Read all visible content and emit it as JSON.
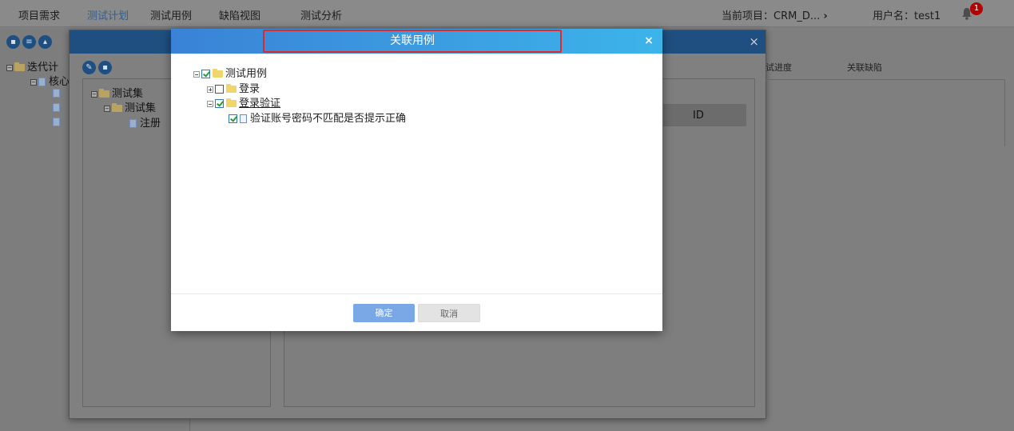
{
  "topnav": {
    "items": [
      "项目需求",
      "测试计划",
      "测试用例",
      "缺陷视图",
      "测试分析"
    ],
    "current_project": "当前项目：CRM_D...",
    "current_project_arrow": "›",
    "username": "用户名：test1",
    "notification_count": "1"
  },
  "bg_sidebar": {
    "tree": [
      "迭代计",
      "核心"
    ]
  },
  "bg_dialog": {
    "close": "×",
    "tree": {
      "root": "测试集",
      "child": "测试集",
      "leaf": "注册"
    },
    "tabs": [
      "试进度",
      "关联缺陷"
    ],
    "table_header_id": "ID"
  },
  "modal": {
    "title": "关联用例",
    "close": "×",
    "tree": {
      "root": "测试用例",
      "node1": "登录",
      "node2": "登录验证",
      "node2_child": "验证账号密码不匹配是否提示正确"
    },
    "buttons": {
      "ok": "确定",
      "cancel": "取消"
    }
  },
  "colors": {
    "header_gradient_start": "#3a82d6",
    "header_gradient_end": "#3cb4ea",
    "title_highlight": "#e02a2a",
    "ok_button": "#7aa8e6",
    "badge": "#b30000"
  }
}
